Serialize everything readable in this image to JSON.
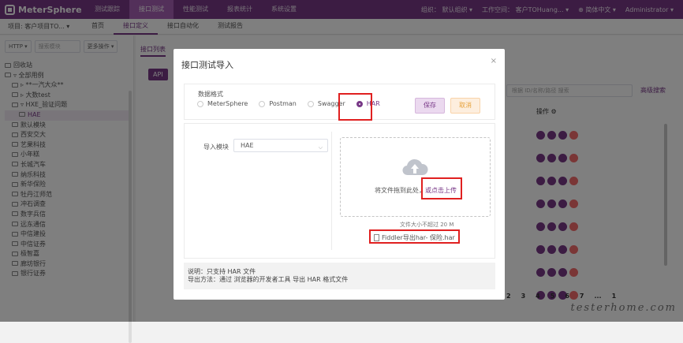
{
  "topbar": {
    "logo": "MeterSphere",
    "nav": [
      "测试跟踪",
      "接口测试",
      "性能测试",
      "报表统计",
      "系统设置"
    ],
    "active_index": 1,
    "org": "组织：  默认组织 ▾",
    "workspace": "工作空间：  客户TOHuang... ▾",
    "lang": "⊕ 简体中文 ▾",
    "user": "Administrator ▾"
  },
  "subbar": {
    "project": "项目: 客户项目TO... ▾",
    "tabs": [
      "首页",
      "接口定义",
      "接口自动化",
      "测试报告"
    ],
    "active_index": 1
  },
  "left_panel": {
    "protocol": "HTTP ▾",
    "search_placeholder": "搜索模块",
    "more_ops": "更多操作 ▾",
    "tree": [
      {
        "label": "回收站",
        "indent": 0
      },
      {
        "label": "▿ 全部用例",
        "indent": 0
      },
      {
        "label": "▹ **一汽大众**",
        "indent": 1
      },
      {
        "label": "▹ 大数test",
        "indent": 1
      },
      {
        "label": "▿ HXE_验证问题",
        "indent": 1
      },
      {
        "label": "HAE",
        "indent": 2,
        "selected": true
      },
      {
        "label": "默认模块",
        "indent": 1
      },
      {
        "label": "西安交大",
        "indent": 1
      },
      {
        "label": "艺果科技",
        "indent": 1
      },
      {
        "label": "小年糕",
        "indent": 1
      },
      {
        "label": "长城汽车",
        "indent": 1
      },
      {
        "label": "纳乐科技",
        "indent": 1
      },
      {
        "label": "新华保险",
        "indent": 1
      },
      {
        "label": "牡丹江师范",
        "indent": 1
      },
      {
        "label": "冲石调查",
        "indent": 1
      },
      {
        "label": "数字兵信",
        "indent": 1
      },
      {
        "label": "远东通信",
        "indent": 1
      },
      {
        "label": "中信建投",
        "indent": 1
      },
      {
        "label": "中信证券",
        "indent": 1
      },
      {
        "label": "极智嘉",
        "indent": 1
      },
      {
        "label": "廊坊银行",
        "indent": 1
      },
      {
        "label": "银行证券",
        "indent": 1
      }
    ]
  },
  "right_panel": {
    "tab": "接口列表",
    "api_btn": "API",
    "search_placeholder": "根据 ID/名称/路径 搜索",
    "adv_search": "高级搜索",
    "ops_header": "操作  ⚙",
    "pager": [
      "2",
      "3",
      "4",
      "5",
      "6",
      "7",
      "...",
      "1"
    ],
    "watermark": "testerhome.com"
  },
  "dialog": {
    "title": "接口测试导入",
    "close": "×",
    "format_label": "数据格式",
    "formats": [
      "MeterSphere",
      "Postman",
      "Swagger",
      "HAR"
    ],
    "selected_format": "HAR",
    "save": "保存",
    "cancel": "取消",
    "module_label": "导入模块",
    "module_value": "HAE",
    "drop_text": "将文件拖到此处，",
    "drop_link": "或点击上传",
    "size_limit": "文件大小不超过 20 M",
    "file_name": "Fiddler导出har-         保险.har",
    "note1": "说明：只支持 HAR 文件",
    "note2": "导出方法：通过 浏览器的开发者工具 导出 HAR 格式文件"
  },
  "colors": {
    "accent": "#783887",
    "highlight": "#e02020"
  }
}
